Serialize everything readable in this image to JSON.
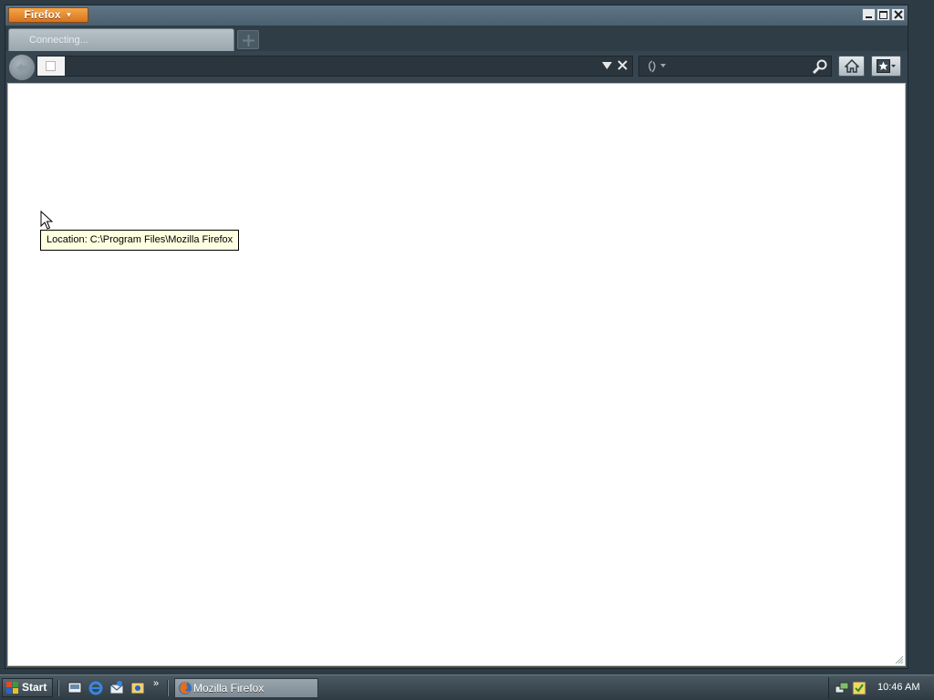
{
  "window": {
    "app_menu_label": "Firefox",
    "controls": [
      "minimize",
      "maximize",
      "close"
    ]
  },
  "tabs": [
    {
      "label": "Connecting..."
    }
  ],
  "navbar": {
    "url_value": "",
    "search_placeholder": ""
  },
  "content": {
    "tooltip": "Location: C:\\Program Files\\Mozilla Firefox"
  },
  "taskbar": {
    "start_label": "Start",
    "quicklaunch_icons": [
      "show-desktop-icon",
      "internet-explorer-icon",
      "outlook-express-icon",
      "media-icon"
    ],
    "overflow_glyph": "»",
    "active_task_label": "Mozilla Firefox",
    "clock": "10:46 AM"
  },
  "colors": {
    "app_button": "#e8862d",
    "chrome_dark": "#35444e",
    "tooltip_bg": "#ffffe1"
  }
}
